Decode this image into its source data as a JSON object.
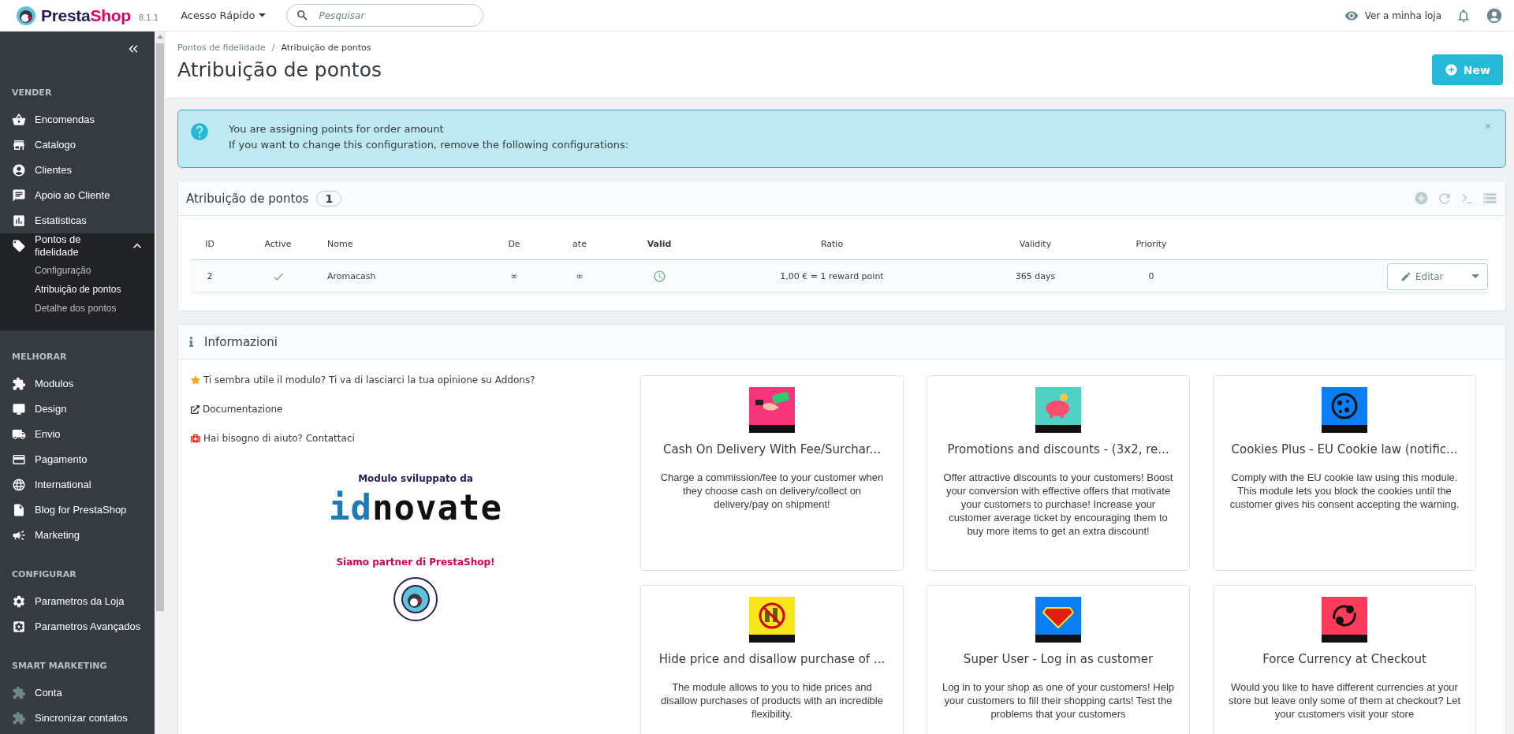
{
  "header": {
    "logo": {
      "first": "Presta",
      "second": "Shop"
    },
    "version": "8.1.1",
    "quick_access": "Acesso Rápido",
    "search": {
      "placeholder": "Pesquisar"
    },
    "store_link": "Ver a minha loja"
  },
  "sidebar": {
    "sections": [
      {
        "title": "VENDER",
        "items": [
          {
            "label": "Encomendas",
            "selected": false
          },
          {
            "label": "Catalogo",
            "selected": false
          },
          {
            "label": "Clientes",
            "selected": false
          },
          {
            "label": "Apoio ao Cliente",
            "selected": false
          },
          {
            "label": "Estatisticas",
            "selected": false
          },
          {
            "label": "Pontos de fidelidade",
            "selected": true,
            "expanded": true,
            "children": [
              {
                "label": "Configuração",
                "selected": false
              },
              {
                "label": "Atribuição de pontos",
                "selected": true
              },
              {
                "label": "Detalhe dos pontos",
                "selected": false
              }
            ]
          }
        ]
      },
      {
        "title": "MELHORAR",
        "items": [
          {
            "label": "Modulos",
            "selected": false
          },
          {
            "label": "Design",
            "selected": false
          },
          {
            "label": "Envio",
            "selected": false
          },
          {
            "label": "Pagamento",
            "selected": false
          },
          {
            "label": "International",
            "selected": false
          },
          {
            "label": "Blog for PrestaShop",
            "selected": false
          },
          {
            "label": "Marketing",
            "selected": false
          }
        ]
      },
      {
        "title": "CONFIGURAR",
        "items": [
          {
            "label": "Parametros da Loja",
            "selected": false
          },
          {
            "label": "Parametros Avançados",
            "selected": false
          }
        ]
      },
      {
        "title": "SMART MARKETING",
        "items": [
          {
            "label": "Conta",
            "selected": false,
            "muted": true
          },
          {
            "label": "Sincronizar contatos",
            "selected": false,
            "muted": true
          }
        ]
      }
    ]
  },
  "breadcrumb": {
    "separator": "/",
    "items": [
      "Pontos de fidelidade",
      "Atribuição de pontos"
    ]
  },
  "page_title": "Atribuição de pontos",
  "new_button": "New",
  "alert": {
    "lines": [
      "You are assigning points for order amount",
      "If you want to change this configuration, remove the following configurations:"
    ]
  },
  "list_panel": {
    "title": "Atribuição de pontos",
    "count": "1",
    "columns": [
      {
        "label": "ID",
        "bold": false
      },
      {
        "label": "Active",
        "bold": false
      },
      {
        "label": "Nome",
        "bold": false
      },
      {
        "label": "De",
        "bold": false
      },
      {
        "label": "ate",
        "bold": false
      },
      {
        "label": "Valid",
        "bold": true
      },
      {
        "label": "Ratio",
        "bold": false
      },
      {
        "label": "Validity",
        "bold": false
      },
      {
        "label": "Priority",
        "bold": false
      }
    ],
    "rows": [
      {
        "id": "2",
        "active": true,
        "name": "Aromacash",
        "from": "∞",
        "to": "∞",
        "valid": true,
        "ratio": "1,00 € = 1 reward point",
        "validity": "365 days",
        "priority": "0",
        "action": "Editar"
      }
    ]
  },
  "info_panel": {
    "title": "Informazioni",
    "links": [
      "Ti sembra utile il modulo? Ti va di lasciarci la tua opinione su Addons?",
      "Documentazione",
      "Hai bisogno di aiuto? Contattaci"
    ],
    "developed_by": "Modulo sviluppato da",
    "developer_logo": {
      "first": "id",
      "second": "novate"
    },
    "partner_text": "Siamo partner di PrestaShop!",
    "modules": [
      {
        "title": "Cash On Delivery With Fee/Surchar...",
        "description": "Charge a commission/fee to your customer when they choose cash on delivery/collect on delivery/pay on shipment!"
      },
      {
        "title": "Promotions and discounts - (3x2, re...",
        "description": "Offer attractive discounts to your customers! Boost your conversion with effective offers that motivate your customers to purchase! Increase your customer average ticket by encouraging them to buy more items to get an extra discount!"
      },
      {
        "title": "Cookies Plus - EU Cookie law (notific...",
        "description": "Comply with the EU cookie law using this module. This module lets you block the cookies until the customer gives his consent accepting the warning."
      },
      {
        "title": "Hide price and disallow purchase of ...",
        "description": "The module allows to you to hide prices and disallow purchases of products with an incredible flexibility."
      },
      {
        "title": "Super User - Log in as customer",
        "description": "Log in to your shop as one of your customers! Help your customers to fill their shopping carts! Test the problems that your customers"
      },
      {
        "title": "Force Currency at Checkout",
        "description": "Would you like to have different currencies at your store but leave only some of them at checkout? Let your customers visit your store"
      }
    ]
  }
}
